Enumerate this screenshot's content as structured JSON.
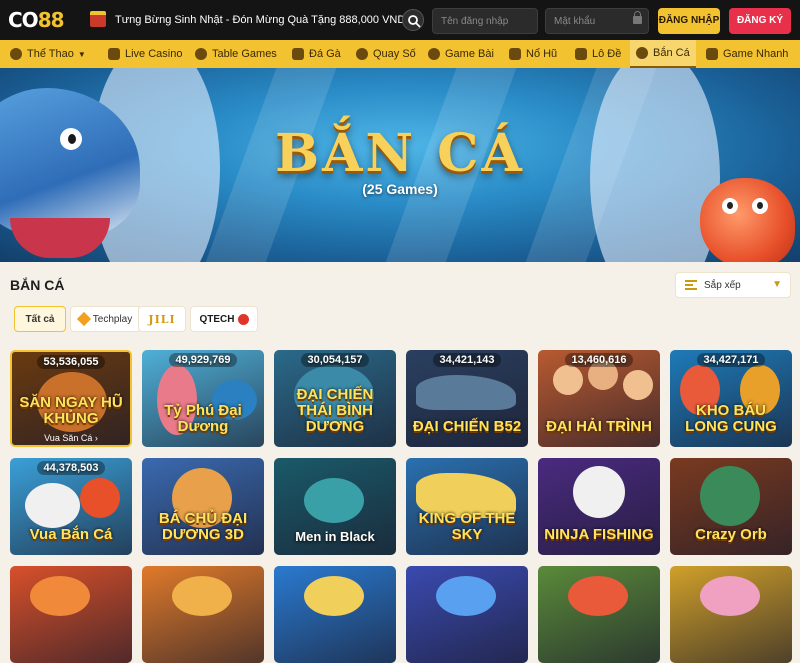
{
  "header": {
    "logo_part1": "CO",
    "logo_part2": "88",
    "promo_text": "Tưng Bừng Sinh Nhật - Đón Mừng Quà Tặng 888,000 VND",
    "username_placeholder": "Tên đăng nhập",
    "password_placeholder": "Mật khẩu",
    "login_label": "ĐĂNG NHẬP",
    "signup_label": "ĐĂNG KÝ"
  },
  "nav": {
    "items": [
      {
        "label": "Thể Thao",
        "icon": "soccer-ball-icon"
      },
      {
        "label": "Live Casino",
        "icon": "cards-icon"
      },
      {
        "label": "Table Games",
        "icon": "poker-chip-icon"
      },
      {
        "label": "Đá Gà",
        "icon": "rooster-icon"
      },
      {
        "label": "Quay Số",
        "icon": "lottery-ball-icon"
      },
      {
        "label": "Game Bài",
        "icon": "club-suit-icon"
      },
      {
        "label": "Nổ Hũ",
        "icon": "slot-machine-icon"
      },
      {
        "label": "Lô Đề",
        "icon": "ticket-icon"
      },
      {
        "label": "Bắn Cá",
        "icon": "crosshair-icon"
      },
      {
        "label": "Game Nhanh",
        "icon": "rocket-icon"
      }
    ],
    "active": "Bắn Cá"
  },
  "banner": {
    "title": "BẮN CÁ",
    "subtitle": "(25 Games)"
  },
  "section": {
    "title": "BẮN CÁ",
    "sort_label": "Sắp xếp"
  },
  "filters": {
    "all_label": "Tất cả",
    "techplay_label": "Techplay",
    "jili_label": "JILI",
    "qtech_label": "QTECH"
  },
  "games": [
    {
      "title": "SĂN NGAY HŨ KHỦNG",
      "count": "53,536,055",
      "subtitle": "Vua Săn Cá ›",
      "bg": "#6a3a10"
    },
    {
      "title": "Tỷ Phú Đại Dương",
      "count": "49,929,769",
      "subtitle": "",
      "bg": "#4fb0d8"
    },
    {
      "title": "ĐẠI CHIẾN THÁI BÌNH DƯƠNG",
      "count": "30,054,157",
      "subtitle": "",
      "bg": "#2a6a8a"
    },
    {
      "title": "ĐẠI CHIẾN B52",
      "count": "34,421,143",
      "subtitle": "",
      "bg": "#2a4060"
    },
    {
      "title": "ĐẠI HẢI TRÌNH",
      "count": "13,460,616",
      "subtitle": "",
      "bg": "#b85a30"
    },
    {
      "title": "KHO BÁU LONG CUNG",
      "count": "34,427,171",
      "subtitle": "",
      "bg": "#1e7ab8"
    },
    {
      "title": "Vua Bắn Cá",
      "count": "44,378,503",
      "subtitle": "",
      "bg": "#3aa0d8"
    },
    {
      "title": "BÁ CHỦ ĐẠI DƯƠNG 3D",
      "count": "",
      "subtitle": "",
      "bg": "#3a6ab0"
    },
    {
      "title": "Men in Black",
      "count": "",
      "subtitle": "",
      "bg": "#1a5a6a"
    },
    {
      "title": "KING OF THE SKY",
      "count": "",
      "subtitle": "",
      "bg": "#2a70b0"
    },
    {
      "title": "NINJA FISHING",
      "count": "",
      "subtitle": "",
      "bg": "#4a2a80"
    },
    {
      "title": "Crazy Orb",
      "count": "",
      "subtitle": "",
      "bg": "#7a3a20"
    },
    {
      "title": "",
      "count": "",
      "subtitle": "",
      "bg": "#d8502a"
    },
    {
      "title": "",
      "count": "",
      "subtitle": "",
      "bg": "#e07a2a"
    },
    {
      "title": "",
      "count": "",
      "subtitle": "",
      "bg": "#2a7ad0"
    },
    {
      "title": "",
      "count": "",
      "subtitle": "",
      "bg": "#3a4ab0"
    },
    {
      "title": "",
      "count": "",
      "subtitle": "",
      "bg": "#5a8a3a"
    },
    {
      "title": "",
      "count": "",
      "subtitle": "",
      "bg": "#d0a02a"
    }
  ]
}
